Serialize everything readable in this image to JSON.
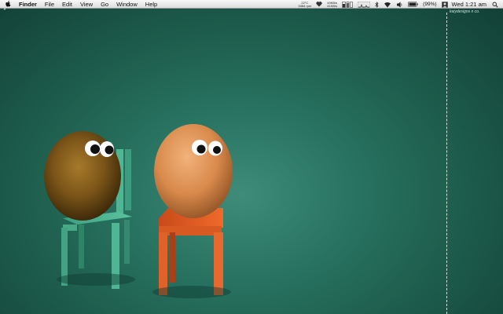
{
  "menubar": {
    "app_name": "Finder",
    "menus": [
      "File",
      "Edit",
      "View",
      "Go",
      "Window",
      "Help"
    ],
    "weather": {
      "temp": "22°C",
      "sub": "3384 rpm"
    },
    "network": {
      "up": "49KB/s",
      "down": "41KB/s"
    },
    "battery": "(99%)",
    "clock": "Wed 1:21 am"
  },
  "wallpaper": {
    "watermark": "kaiydesigns n co."
  }
}
